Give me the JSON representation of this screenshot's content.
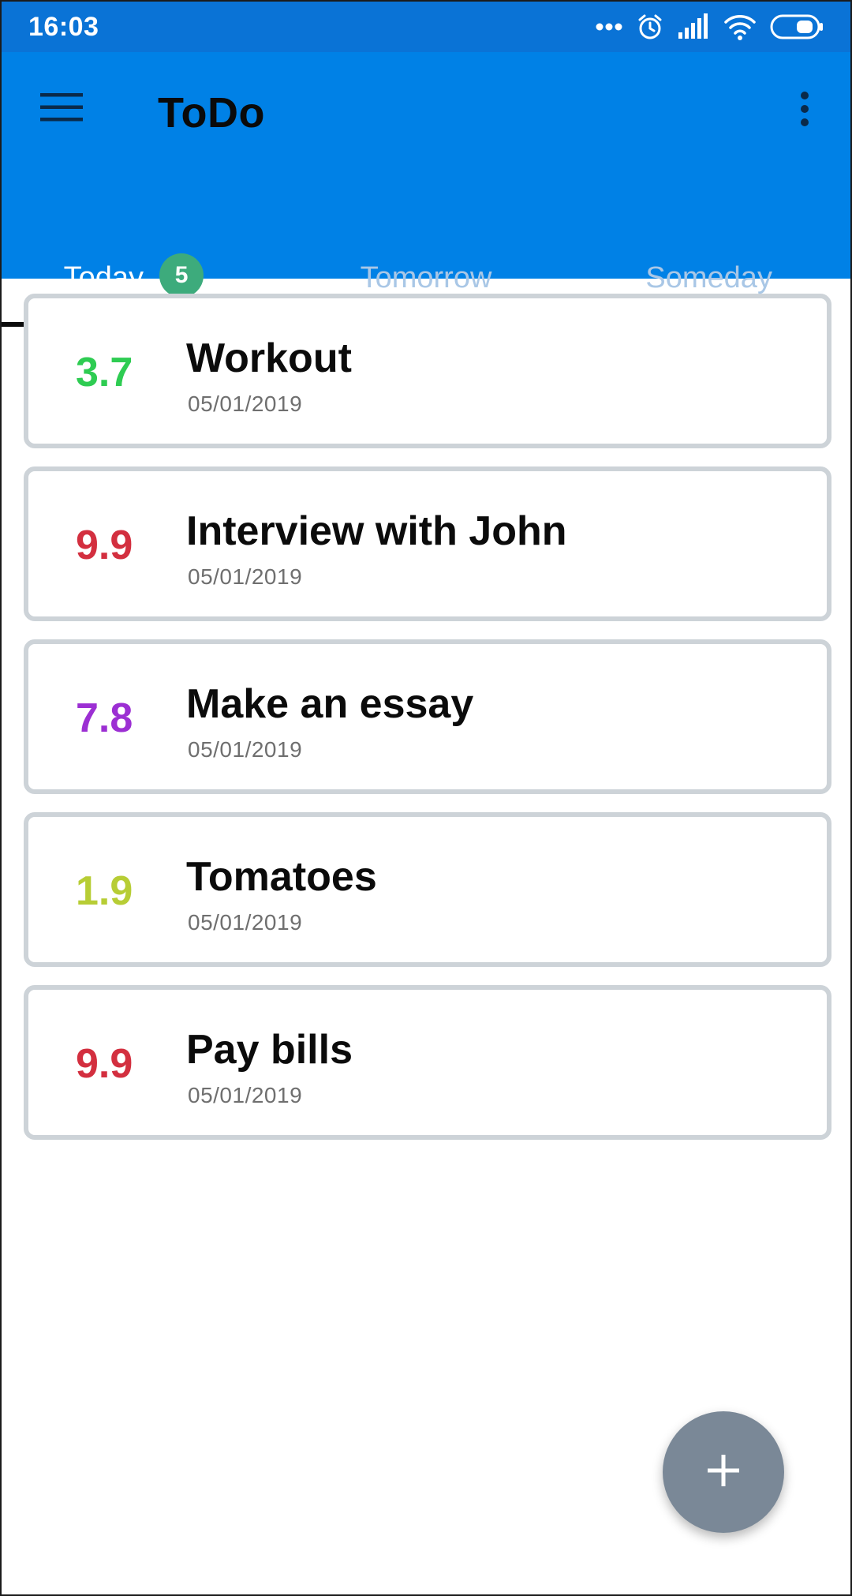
{
  "status_bar": {
    "time": "16:03",
    "icons": [
      "more-dots-icon",
      "alarm-icon",
      "signal-icon",
      "wifi-icon",
      "battery-icon"
    ]
  },
  "app_bar": {
    "title": "ToDo",
    "menu_icon": "hamburger-menu-icon",
    "more_icon": "overflow-menu-icon",
    "color": "#0081e6"
  },
  "tabs": [
    {
      "label": "Today",
      "badge": "5",
      "active": true
    },
    {
      "label": "Tomorrow",
      "active": false
    },
    {
      "label": "Someday",
      "active": false
    }
  ],
  "tasks": [
    {
      "score": "3.7",
      "score_color": "#2ecc52",
      "title": "Workout",
      "date": "05/01/2019"
    },
    {
      "score": "9.9",
      "score_color": "#d32f3f",
      "title": "Interview with John",
      "date": "05/01/2019"
    },
    {
      "score": "7.8",
      "score_color": "#9c2fd3",
      "title": "Make an essay",
      "date": "05/01/2019"
    },
    {
      "score": "1.9",
      "score_color": "#b7cd35",
      "title": "Tomatoes",
      "date": "05/01/2019"
    },
    {
      "score": "9.9",
      "score_color": "#d32f3f",
      "title": "Pay bills",
      "date": "05/01/2019"
    }
  ],
  "fab": {
    "icon": "plus-icon",
    "color": "#7a8897"
  }
}
